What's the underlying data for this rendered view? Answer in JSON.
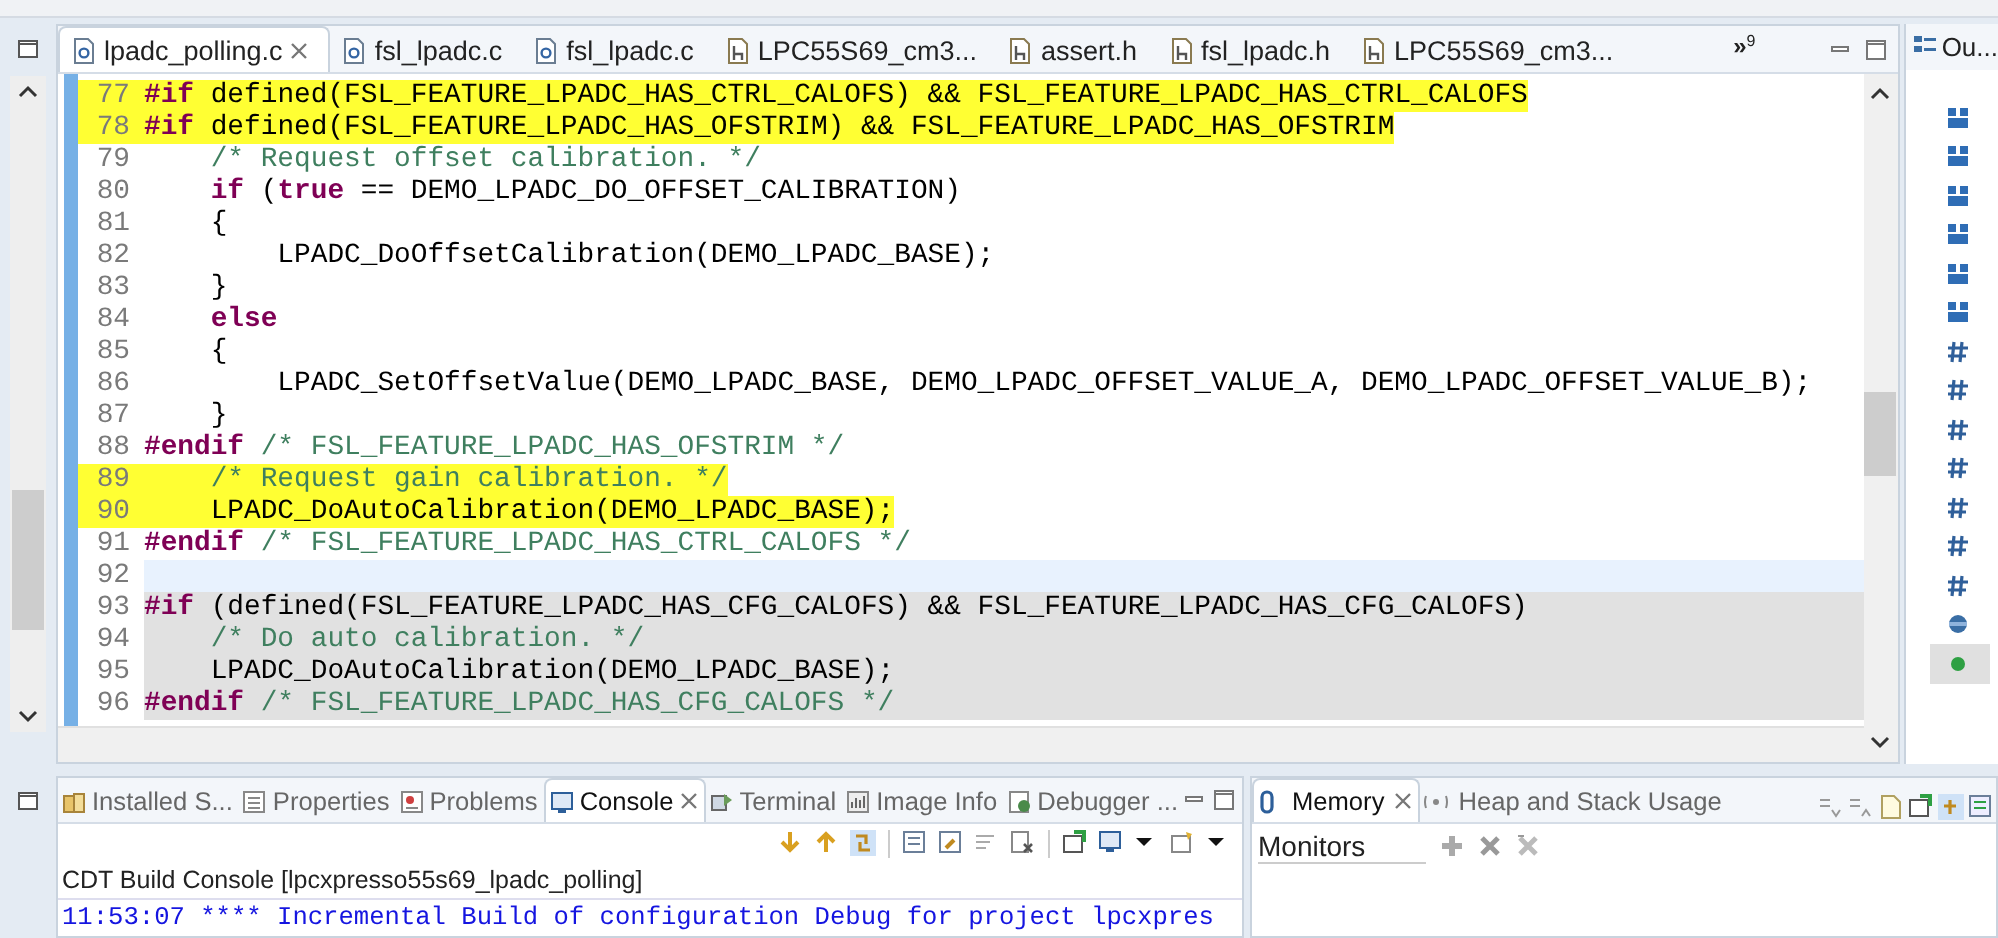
{
  "editor": {
    "tabs": [
      {
        "label": "lpadc_polling.c",
        "kind": "source",
        "selected": true
      },
      {
        "label": "fsl_lpadc.c",
        "kind": "source",
        "selected": false
      },
      {
        "label": "fsl_lpadc.c",
        "kind": "source",
        "selected": false
      },
      {
        "label": "LPC55S69_cm3...",
        "kind": "header",
        "selected": false
      },
      {
        "label": "assert.h",
        "kind": "header",
        "selected": false
      },
      {
        "label": "fsl_lpadc.h",
        "kind": "header",
        "selected": false
      },
      {
        "label": "LPC55S69_cm3...",
        "kind": "header",
        "selected": false
      }
    ],
    "overflow": {
      "arrows": "»",
      "count": "9"
    },
    "lines": [
      {
        "number": "77",
        "current": false,
        "inactive": false,
        "highlighted": true,
        "segments": [
          {
            "kind": "directive",
            "text": "#if"
          },
          {
            "kind": "plain",
            "text": " defined(FSL_FEATURE_LPADC_HAS_CTRL_CALOFS) && FSL_FEATURE_LPADC_HAS_CTRL_CALOFS"
          }
        ]
      },
      {
        "number": "78",
        "current": false,
        "inactive": false,
        "highlighted": true,
        "segments": [
          {
            "kind": "directive",
            "text": "#if"
          },
          {
            "kind": "plain",
            "text": " defined(FSL_FEATURE_LPADC_HAS_OFSTRIM) && FSL_FEATURE_LPADC_HAS_OFSTRIM"
          }
        ]
      },
      {
        "number": "79",
        "current": false,
        "inactive": false,
        "highlighted": false,
        "segments": [
          {
            "kind": "comment",
            "text": "    /* Request offset calibration. */"
          }
        ]
      },
      {
        "number": "80",
        "current": false,
        "inactive": false,
        "highlighted": false,
        "segments": [
          {
            "kind": "keyword",
            "text": "    if"
          },
          {
            "kind": "plain",
            "text": " ("
          },
          {
            "kind": "keyword",
            "text": "true"
          },
          {
            "kind": "plain",
            "text": " == DEMO_LPADC_DO_OFFSET_CALIBRATION)"
          }
        ]
      },
      {
        "number": "81",
        "current": false,
        "inactive": false,
        "highlighted": false,
        "segments": [
          {
            "kind": "plain",
            "text": "    {"
          }
        ]
      },
      {
        "number": "82",
        "current": false,
        "inactive": false,
        "highlighted": false,
        "segments": [
          {
            "kind": "plain",
            "text": "        LPADC_DoOffsetCalibration(DEMO_LPADC_BASE);"
          }
        ]
      },
      {
        "number": "83",
        "current": false,
        "inactive": false,
        "highlighted": false,
        "segments": [
          {
            "kind": "plain",
            "text": "    }"
          }
        ]
      },
      {
        "number": "84",
        "current": false,
        "inactive": false,
        "highlighted": false,
        "segments": [
          {
            "kind": "keyword",
            "text": "    else"
          }
        ]
      },
      {
        "number": "85",
        "current": false,
        "inactive": false,
        "highlighted": false,
        "segments": [
          {
            "kind": "plain",
            "text": "    {"
          }
        ]
      },
      {
        "number": "86",
        "current": false,
        "inactive": false,
        "highlighted": false,
        "segments": [
          {
            "kind": "plain",
            "text": "        LPADC_SetOffsetValue(DEMO_LPADC_BASE, DEMO_LPADC_OFFSET_VALUE_A, DEMO_LPADC_OFFSET_VALUE_B);"
          }
        ]
      },
      {
        "number": "87",
        "current": false,
        "inactive": false,
        "highlighted": false,
        "segments": [
          {
            "kind": "plain",
            "text": "    }"
          }
        ]
      },
      {
        "number": "88",
        "current": false,
        "inactive": false,
        "highlighted": false,
        "segments": [
          {
            "kind": "directive",
            "text": "#endif"
          },
          {
            "kind": "comment",
            "text": " /* FSL_FEATURE_LPADC_HAS_OFSTRIM */"
          }
        ]
      },
      {
        "number": "89",
        "current": false,
        "inactive": false,
        "highlighted": true,
        "segments": [
          {
            "kind": "comment",
            "text": "    /* Request gain calibration. */"
          }
        ]
      },
      {
        "number": "90",
        "current": false,
        "inactive": false,
        "highlighted": true,
        "segments": [
          {
            "kind": "plain",
            "text": "    LPADC_DoAutoCalibration(DEMO_LPADC_BASE);"
          }
        ]
      },
      {
        "number": "91",
        "current": false,
        "inactive": false,
        "highlighted": false,
        "segments": [
          {
            "kind": "directive",
            "text": "#endif"
          },
          {
            "kind": "comment",
            "text": " /* FSL_FEATURE_LPADC_HAS_CTRL_CALOFS */"
          }
        ]
      },
      {
        "number": "92",
        "current": true,
        "inactive": false,
        "highlighted": false
      },
      {
        "number": "93",
        "current": false,
        "inactive": true,
        "highlighted": false,
        "segments": [
          {
            "kind": "directive",
            "text": "#if"
          },
          {
            "kind": "plain",
            "text": " (defined(FSL_FEATURE_LPADC_HAS_CFG_CALOFS) && FSL_FEATURE_LPADC_HAS_CFG_CALOFS)"
          }
        ]
      },
      {
        "number": "94",
        "current": false,
        "inactive": true,
        "highlighted": false,
        "segments": [
          {
            "kind": "comment",
            "text": "    /* Do auto calibration. */"
          }
        ]
      },
      {
        "number": "95",
        "current": false,
        "inactive": true,
        "highlighted": false,
        "segments": [
          {
            "kind": "plain",
            "text": "    LPADC_DoAutoCalibration(DEMO_LPADC_BASE);"
          }
        ]
      },
      {
        "number": "96",
        "current": false,
        "inactive": true,
        "highlighted": false,
        "segments": [
          {
            "kind": "directive",
            "text": "#endif"
          },
          {
            "kind": "comment",
            "text": " /* FSL_FEATURE_LPADC_HAS_CFG_CALOFS */"
          }
        ]
      }
    ]
  },
  "outline": {
    "title": "Ou...",
    "items": [
      {
        "kind": "type"
      },
      {
        "kind": "type"
      },
      {
        "kind": "type"
      },
      {
        "kind": "type"
      },
      {
        "kind": "type"
      },
      {
        "kind": "type"
      },
      {
        "kind": "macro"
      },
      {
        "kind": "macro"
      },
      {
        "kind": "macro"
      },
      {
        "kind": "macro"
      },
      {
        "kind": "macro"
      },
      {
        "kind": "macro"
      },
      {
        "kind": "macro"
      },
      {
        "kind": "variable"
      },
      {
        "kind": "function"
      }
    ]
  },
  "console": {
    "tabs": [
      {
        "label": "Installed S...",
        "selected": false
      },
      {
        "label": "Properties",
        "selected": false
      },
      {
        "label": "Problems",
        "selected": false
      },
      {
        "label": "Console",
        "selected": true
      },
      {
        "label": "Terminal",
        "selected": false
      },
      {
        "label": "Image Info",
        "selected": false
      },
      {
        "label": "Debugger ...",
        "selected": false
      }
    ],
    "header": "CDT Build Console [lpcxpresso55s69_lpadc_polling]",
    "output": [
      {
        "kind": "info",
        "text": "11:53:07 **** Incremental Build of configuration Debug for project lpcxpres"
      }
    ]
  },
  "memory": {
    "tabs": [
      {
        "label": "Memory",
        "selected": true
      },
      {
        "label": "Heap and Stack Usage",
        "selected": false
      }
    ],
    "monitors": "Monitors"
  }
}
